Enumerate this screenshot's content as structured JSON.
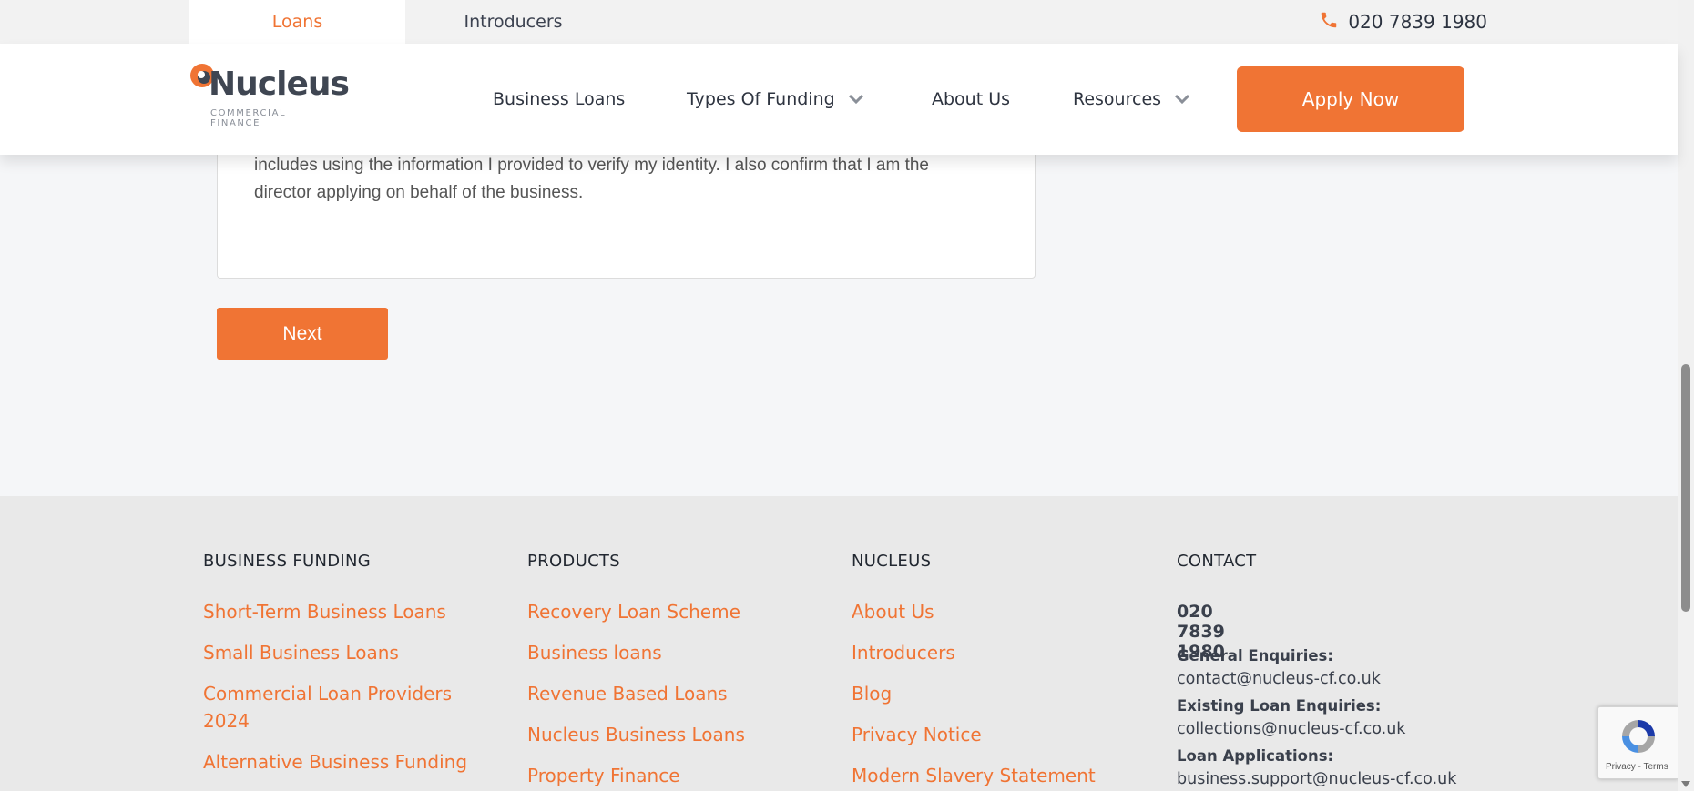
{
  "utility_bar": {
    "tabs": [
      "Loans",
      "Introducers"
    ],
    "phone": "020 7839 1980"
  },
  "logo": {
    "name": "Nucleus",
    "tagline": "COMMERCIAL FINANCE"
  },
  "nav": {
    "items": [
      "Business Loans",
      "Types Of Funding",
      "About Us",
      "Resources"
    ],
    "apply_label": "Apply Now"
  },
  "consent": {
    "line1": "includes using the information I provided to verify my identity. I also confirm that I am the",
    "line2": "director applying on behalf of the business."
  },
  "form": {
    "next_label": "Next"
  },
  "footer": {
    "business_funding": {
      "heading": "BUSINESS FUNDING",
      "links": [
        "Short-Term Business Loans",
        "Small Business Loans",
        "Commercial Loan Providers",
        "2024",
        "Alternative Business Funding"
      ]
    },
    "products": {
      "heading": "PRODUCTS",
      "links": [
        "Recovery Loan Scheme",
        "Business loans",
        "Revenue Based Loans",
        "Nucleus Business Loans",
        "Property Finance"
      ]
    },
    "nucleus": {
      "heading": "NUCLEUS",
      "links": [
        "About Us",
        "Introducers",
        "Blog",
        "Privacy Notice",
        "Modern Slavery Statement"
      ]
    },
    "contact": {
      "heading": "CONTACT",
      "phone": "020 7839 1980",
      "general_label": "General Enquiries:",
      "general_email": "contact@nucleus-cf.co.uk",
      "existing_label": "Existing Loan Enquiries:",
      "existing_email": "collections@nucleus-cf.co.uk",
      "applications_label": "Loan Applications:",
      "applications_email": "business.support@nucleus-cf.co.uk"
    }
  },
  "recaptcha": {
    "text": "Privacy - Terms"
  },
  "colors": {
    "brand_orange": "#f07434",
    "dark_text": "#2e3440",
    "footer_bg": "#e9e9e9"
  }
}
